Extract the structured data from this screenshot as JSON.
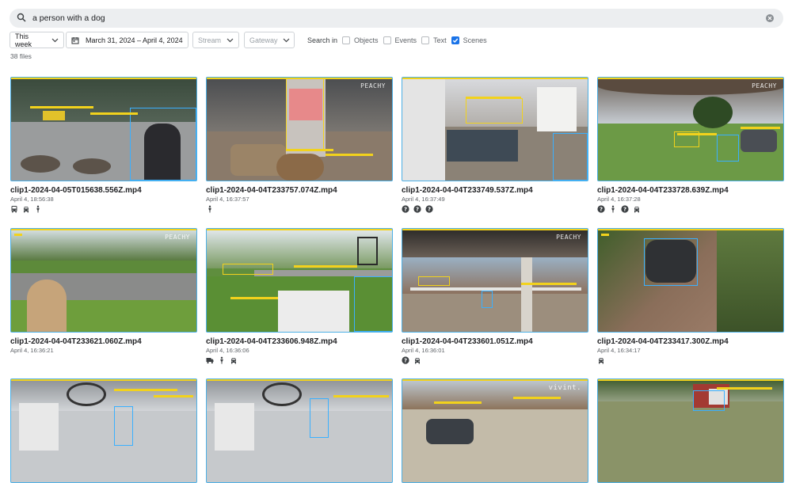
{
  "search": {
    "query": "a person with a dog"
  },
  "filters": {
    "range": "This week",
    "dates": "March 31, 2024 – April 4, 2024",
    "stream_placeholder": "Stream",
    "gateway_placeholder": "Gateway",
    "search_in_label": "Search in",
    "options": [
      {
        "label": "Objects",
        "checked": false
      },
      {
        "label": "Events",
        "checked": false
      },
      {
        "label": "Text",
        "checked": false
      },
      {
        "label": "Scenes",
        "checked": true
      }
    ]
  },
  "file_count": "38 files",
  "results": [
    {
      "name": "clip1-2024-04-05T015638.556Z.mp4",
      "time": "April 4, 18:56:38",
      "icons": [
        "bus-icon",
        "car-icon",
        "person-icon"
      ]
    },
    {
      "name": "clip1-2024-04-04T233757.074Z.mp4",
      "time": "April 4, 16:37:57",
      "icons": [
        "person-icon"
      ]
    },
    {
      "name": "clip1-2024-04-04T233749.537Z.mp4",
      "time": "April 4, 16:37:49",
      "icons": [
        "unknown-icon",
        "unknown-icon",
        "unknown-icon"
      ]
    },
    {
      "name": "clip1-2024-04-04T233728.639Z.mp4",
      "time": "April 4, 16:37:28",
      "icons": [
        "unknown-icon",
        "person-icon",
        "unknown-icon",
        "car-icon"
      ]
    },
    {
      "name": "clip1-2024-04-04T233621.060Z.mp4",
      "time": "April 4, 16:36:21",
      "icons": []
    },
    {
      "name": "clip1-2024-04-04T233606.948Z.mp4",
      "time": "April 4, 16:36:06",
      "icons": [
        "truck-icon",
        "person-icon",
        "car-icon"
      ]
    },
    {
      "name": "clip1-2024-04-04T233601.051Z.mp4",
      "time": "April 4, 16:36:01",
      "icons": [
        "unknown-icon",
        "car-icon"
      ]
    },
    {
      "name": "clip1-2024-04-04T233417.300Z.mp4",
      "time": "April 4, 16:34:17",
      "icons": [
        "car-icon"
      ]
    },
    {
      "name": "",
      "time": "",
      "icons": []
    },
    {
      "name": "",
      "time": "",
      "icons": []
    },
    {
      "name": "",
      "time": "",
      "icons": []
    },
    {
      "name": "",
      "time": "",
      "icons": []
    }
  ],
  "watermarks": {
    "peachy": "PEACHY",
    "vivint": "vivint."
  },
  "colors": {
    "accent": "#1a73e8",
    "detection_yellow": "#f2d21c",
    "detection_blue": "#3ab0ff"
  }
}
